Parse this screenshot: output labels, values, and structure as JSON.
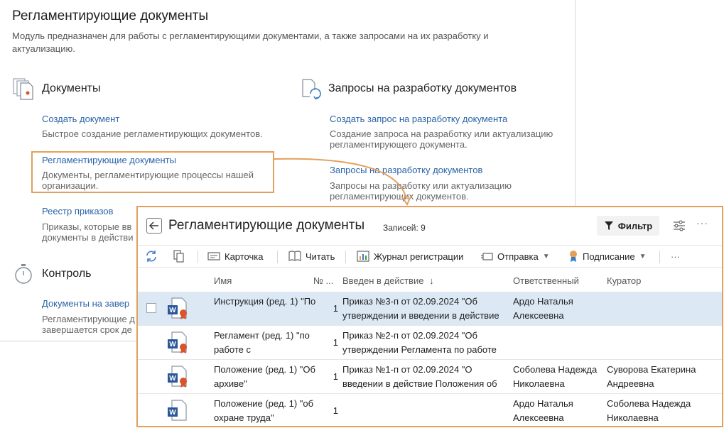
{
  "module": {
    "title": "Регламентирующие документы",
    "description": "Модуль предназначен для работы с регламентирующими документами, а также запросами на их разработку и актуализацию.",
    "sections": {
      "documents": {
        "title": "Документы",
        "links": [
          {
            "label": "Создать документ",
            "desc": "Быстрое создание регламентирующих документов."
          },
          {
            "label": "Регламентирующие документы",
            "desc": "Документы, регламентирующие процессы нашей организации."
          },
          {
            "label": "Реестр приказов",
            "desc_line1": "Приказы, которые вв",
            "desc_line2": "документы в действи"
          }
        ]
      },
      "requests": {
        "title": "Запросы на разработку документов",
        "links": [
          {
            "label": "Создать запрос на разработку документа",
            "desc": "Создание запроса на разработку или актуализацию регламентирующего документа."
          },
          {
            "label": "Запросы на разработку документов",
            "desc": "Запросы на разработку или актуализацию регламентирующих документов."
          }
        ]
      },
      "control": {
        "title": "Контроль",
        "links": [
          {
            "label": "Документы на завер",
            "desc_line1": "Регламентирующие д",
            "desc_line2": "завершается срок де"
          }
        ]
      }
    }
  },
  "list": {
    "title": "Регламентирующие документы",
    "count_label": "Записей: 9",
    "filter_label": "Фильтр",
    "more": "···",
    "toolbar": {
      "card": "Карточка",
      "read": "Читать",
      "journal": "Журнал регистрации",
      "send": "Отправка",
      "sign": "Подписание",
      "more": "···"
    },
    "columns": {
      "name": "Имя",
      "num": "№ ...",
      "order": "Введен в действие",
      "responsible": "Ответственный",
      "curator": "Куратор"
    },
    "rows": [
      {
        "name": "Инструкция (ред. 1) \"По",
        "num": "1",
        "order": "Приказ №3-п от 02.09.2024 \"Об утверждении и введении в действие",
        "responsible": "Ардо Наталья Алексеевна",
        "curator": "",
        "signed": true
      },
      {
        "name": "Регламент (ред. 1) \"по работе с",
        "num": "1",
        "order": "Приказ №2-п от 02.09.2024 \"Об утверждении Регламента по работе",
        "responsible": "",
        "curator": "",
        "signed": true
      },
      {
        "name": "Положение (ред. 1) \"Об архиве\"",
        "num": "1",
        "order": "Приказ №1-п от 02.09.2024 \"О введении в действие Положения об",
        "responsible": "Соболева Надежда Николаевна",
        "curator": "Суворова Екатерина Андреевна",
        "signed": true
      },
      {
        "name": "Положение (ред. 1) \"об охране труда\"",
        "num": "1",
        "order": "",
        "responsible": "Ардо Наталья Алексеевна",
        "curator": "Соболева Надежда Николаевна",
        "signed": false
      }
    ]
  },
  "colors": {
    "accent": "#e2a05c",
    "link": "#2a64a8",
    "selected_row": "#dce9f5",
    "word_blue": "#2b579a",
    "seal_red": "#d9532c"
  }
}
